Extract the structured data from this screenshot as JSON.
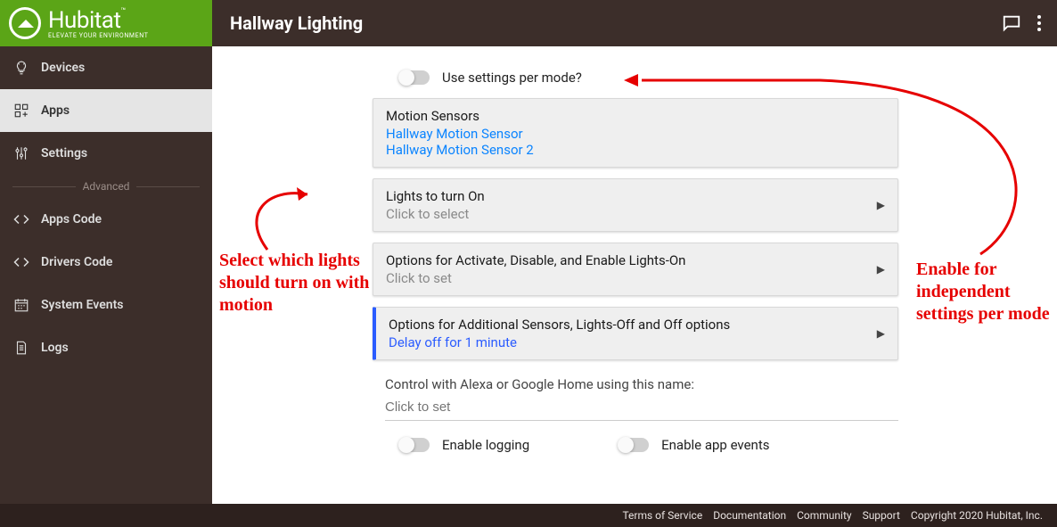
{
  "brand": {
    "name": "Hubitat",
    "tag": "ELEVATE YOUR ENVIRONMENT",
    "tm": "™"
  },
  "page_title": "Hallway Lighting",
  "sidebar": {
    "items": [
      {
        "label": "Devices"
      },
      {
        "label": "Apps"
      },
      {
        "label": "Settings"
      }
    ],
    "divider": "Advanced",
    "advanced": [
      {
        "label": "Apps Code"
      },
      {
        "label": "Drivers Code"
      },
      {
        "label": "System Events"
      },
      {
        "label": "Logs"
      }
    ]
  },
  "settings_per_mode_label": "Use settings per mode?",
  "motion_sensors": {
    "title": "Motion Sensors",
    "items": [
      "Hallway Motion Sensor",
      "Hallway Motion Sensor 2"
    ]
  },
  "lights_on": {
    "title": "Lights to turn On",
    "sub": "Click to select"
  },
  "opts_activate": {
    "title": "Options for Activate, Disable, and Enable Lights-On",
    "sub": "Click to set"
  },
  "opts_additional": {
    "title": "Options for Additional Sensors, Lights-Off and Off options",
    "value": "Delay off for 1 minute"
  },
  "voice_control": {
    "label": "Control with Alexa or Google Home using this name:",
    "placeholder": "Click to set"
  },
  "enable_logging_label": "Enable logging",
  "enable_app_events_label": "Enable app events",
  "annotations": {
    "left": "Select which lights should turn on with motion",
    "right": "Enable for independent settings per mode"
  },
  "footer": {
    "links": [
      "Terms of Service",
      "Documentation",
      "Community",
      "Support"
    ],
    "copyright": "Copyright 2020 Hubitat, Inc."
  }
}
